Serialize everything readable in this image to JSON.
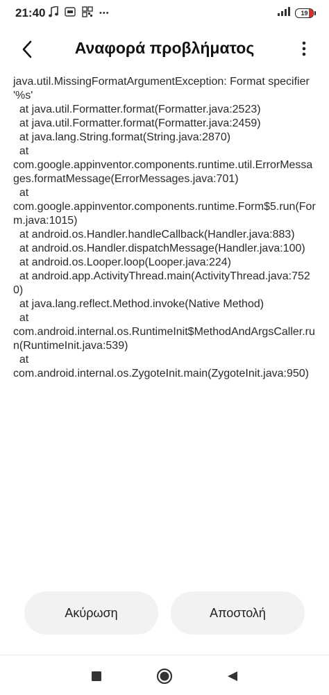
{
  "status_bar": {
    "time": "21:40",
    "battery_level": "19",
    "more_indicator": "•••",
    "icons": [
      "music-note-icon",
      "hd-icon",
      "qr-icon",
      "signal-icon",
      "battery-icon"
    ]
  },
  "header": {
    "title": "Αναφορά προβλήματος",
    "back_icon": "chevron-left-icon",
    "menu_icon": "more-vertical-icon"
  },
  "report": {
    "text": "java.util.MissingFormatArgumentException: Format specifier '%s'\n  at java.util.Formatter.format(Formatter.java:2523)\n  at java.util.Formatter.format(Formatter.java:2459)\n  at java.lang.String.format(String.java:2870)\n  at\ncom.google.appinventor.components.runtime.util.ErrorMessages.formatMessage(ErrorMessages.java:701)\n  at\ncom.google.appinventor.components.runtime.Form$5.run(Form.java:1015)\n  at android.os.Handler.handleCallback(Handler.java:883)\n  at android.os.Handler.dispatchMessage(Handler.java:100)\n  at android.os.Looper.loop(Looper.java:224)\n  at android.app.ActivityThread.main(ActivityThread.java:7520)\n  at java.lang.reflect.Method.invoke(Native Method)\n  at\ncom.android.internal.os.RuntimeInit$MethodAndArgsCaller.run(RuntimeInit.java:539)\n  at\ncom.android.internal.os.ZygoteInit.main(ZygoteInit.java:950)"
  },
  "actions": {
    "cancel_label": "Ακύρωση",
    "send_label": "Αποστολή"
  },
  "nav": {
    "icons": [
      "recents-square-icon",
      "home-circle-icon",
      "back-triangle-icon"
    ]
  },
  "colors": {
    "battery_low": "#d9302c",
    "button_bg": "#f2f2f2",
    "text": "#2a2a2a"
  }
}
